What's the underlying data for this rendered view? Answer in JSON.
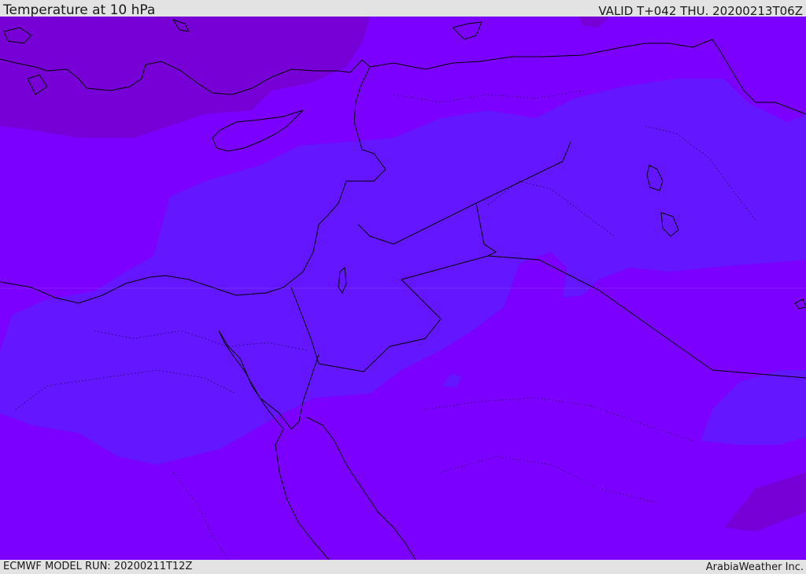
{
  "header": {
    "title": "Temperature at 10 hPa",
    "valid": "VALID T+042 THU. 20200213T06Z"
  },
  "footer": {
    "model_run": "ECMWF MODEL RUN: 20200211T12Z",
    "credit": "ArabiaWeather Inc."
  },
  "map": {
    "colors": {
      "warm_field": "#7c00ff",
      "cold_band": "#6316ff",
      "warmer_patch": "#7700d6",
      "coastline": "#000000"
    }
  }
}
